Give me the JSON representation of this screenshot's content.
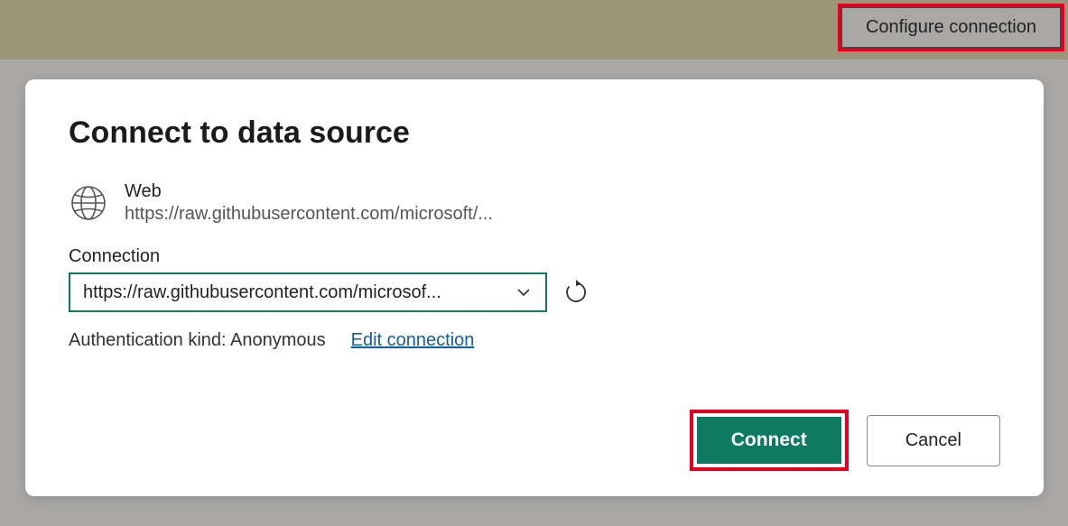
{
  "header": {
    "configure_label": "Configure connection"
  },
  "dialog": {
    "title": "Connect to data source",
    "source": {
      "name": "Web",
      "url": "https://raw.githubusercontent.com/microsoft/..."
    },
    "connection": {
      "label": "Connection",
      "selected": "https://raw.githubusercontent.com/microsof..."
    },
    "auth": {
      "text": "Authentication kind: Anonymous",
      "edit_label": "Edit connection"
    },
    "buttons": {
      "connect": "Connect",
      "cancel": "Cancel"
    }
  }
}
